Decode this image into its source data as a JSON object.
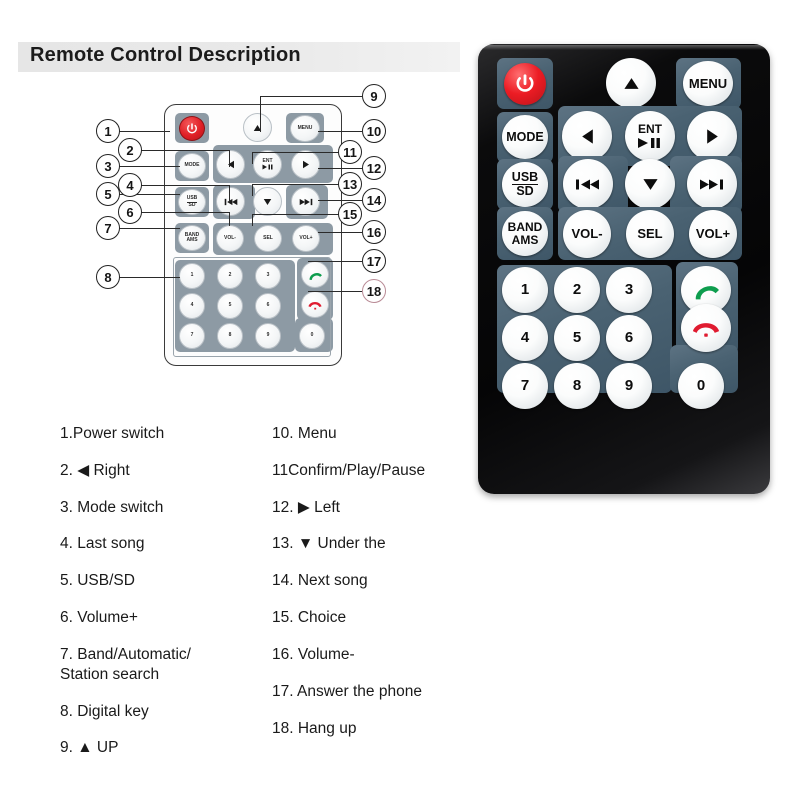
{
  "page": {
    "title": "Remote Control Description",
    "background": "#ffffff",
    "banner_color": "#e8e8e8"
  },
  "colors": {
    "remote_body": "#0a0a0b",
    "keypad_panel": "#4a6272",
    "button_face": "#f4f7f8",
    "power_red": "#ec1c24",
    "answer_green": "#0e9d4e",
    "hangup_red": "#e01b30",
    "callout_outline": "#222222"
  },
  "remote": {
    "name": "car-audio-ir-remote",
    "buttons": [
      {
        "id": "power",
        "label": "",
        "icon": "power-icon",
        "row": 1,
        "col": 1
      },
      {
        "id": "up",
        "label": "",
        "icon": "triangle-up-icon",
        "row": 1,
        "col": 3
      },
      {
        "id": "menu",
        "label": "MENU",
        "icon": "",
        "row": 1,
        "col": 4
      },
      {
        "id": "mode",
        "label": "MODE",
        "icon": "",
        "row": 2,
        "col": 1
      },
      {
        "id": "left",
        "label": "",
        "icon": "triangle-left-icon",
        "row": 2,
        "col": 2
      },
      {
        "id": "ent",
        "label": "ENT",
        "icon": "play-pause-icon",
        "row": 2,
        "col": 3
      },
      {
        "id": "right",
        "label": "",
        "icon": "triangle-right-icon",
        "row": 2,
        "col": 4
      },
      {
        "id": "usbsd",
        "label": "USB/SD",
        "icon": "",
        "row": 3,
        "col": 1
      },
      {
        "id": "prev",
        "label": "",
        "icon": "prev-track-icon",
        "row": 3,
        "col": 2
      },
      {
        "id": "down",
        "label": "",
        "icon": "triangle-down-icon",
        "row": 3,
        "col": 3
      },
      {
        "id": "next",
        "label": "",
        "icon": "next-track-icon",
        "row": 3,
        "col": 4
      },
      {
        "id": "bandams",
        "label": "BAND/AMS",
        "icon": "",
        "row": 4,
        "col": 1
      },
      {
        "id": "volminus",
        "label": "VOL-",
        "icon": "",
        "row": 4,
        "col": 2
      },
      {
        "id": "sel",
        "label": "SEL",
        "icon": "",
        "row": 4,
        "col": 3
      },
      {
        "id": "volplus",
        "label": "VOL+",
        "icon": "",
        "row": 4,
        "col": 4
      }
    ],
    "labels": {
      "menu": "MENU",
      "mode": "MODE",
      "usb": "USB",
      "sd": "SD",
      "ent": "ENT",
      "band": "BAND",
      "ams": "AMS",
      "vol_minus": "VOL-",
      "sel": "SEL",
      "vol_plus": "VOL+"
    },
    "keypad": [
      [
        "1",
        "2",
        "3"
      ],
      [
        "4",
        "5",
        "6"
      ],
      [
        "7",
        "8",
        "9"
      ]
    ],
    "zero_key": "0",
    "call_keys": {
      "answer": "answer-call-icon",
      "hangup": "hang-up-call-icon"
    }
  },
  "callouts": {
    "left": [
      "1",
      "2",
      "3",
      "4",
      "5",
      "6",
      "7",
      "8"
    ],
    "right": [
      "9",
      "10",
      "11",
      "12",
      "13",
      "14",
      "15",
      "16",
      "17",
      "18"
    ]
  },
  "descriptions": {
    "left_column": [
      "1.Power switch",
      "2. ◀ Right",
      "3. Mode switch",
      "4. Last song",
      "5. USB/SD",
      "6. Volume+",
      "7. Band/Automatic/\nStation search",
      "8. Digital key",
      "9. ▲ UP"
    ],
    "right_column": [
      "10. Menu",
      "11Confirm/Play/Pause",
      "12.  ▶  Left",
      "13.  ▼  Under the",
      "14. Next song",
      "15. Choice",
      "16. Volume-",
      "17. Answer the phone",
      "18. Hang up"
    ]
  }
}
